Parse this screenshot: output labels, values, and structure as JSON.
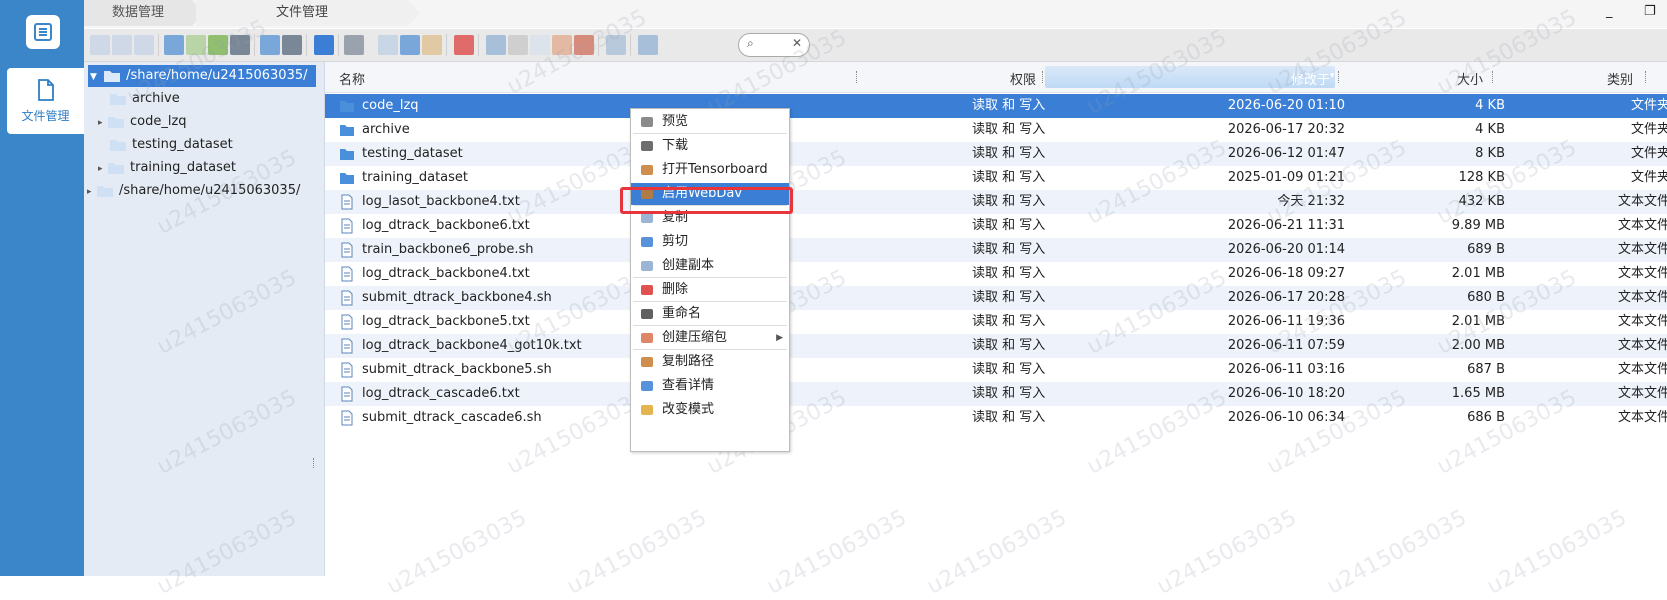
{
  "nav": {
    "active_label": "文件管理"
  },
  "tabs": [
    {
      "label": "数据管理"
    },
    {
      "label": "文件管理"
    }
  ],
  "window": {
    "minimize": "_",
    "restore": "❐"
  },
  "search": {
    "placeholder": "",
    "glyph": "⌕",
    "clear": "✕"
  },
  "tree": {
    "root": "/share/home/u2415063035/",
    "children": [
      "archive",
      "code_lzq",
      "testing_dataset",
      "training_dataset"
    ],
    "second_root": "/share/home/u2415063035/"
  },
  "columns": {
    "name": "名称",
    "perm": "权限",
    "modified": "修改于",
    "size": "大小",
    "type": "类别"
  },
  "files": [
    {
      "name": "code_lzq",
      "perm": "读取 和 写入",
      "modified": "2026-06-20 01:10",
      "size": "4 KB",
      "type": "文件夹",
      "kind": "folder"
    },
    {
      "name": "archive",
      "perm": "读取 和 写入",
      "modified": "2026-06-17 20:32",
      "size": "4 KB",
      "type": "文件夹",
      "kind": "folder"
    },
    {
      "name": "testing_dataset",
      "perm": "读取 和 写入",
      "modified": "2026-06-12 01:47",
      "size": "8 KB",
      "type": "文件夹",
      "kind": "folder"
    },
    {
      "name": "training_dataset",
      "perm": "读取 和 写入",
      "modified": "2025-01-09 01:21",
      "size": "128 KB",
      "type": "文件夹",
      "kind": "folder"
    },
    {
      "name": "log_lasot_backbone4.txt",
      "perm": "读取 和 写入",
      "modified": "今天 21:32",
      "size": "432 KB",
      "type": "文本文件",
      "kind": "file"
    },
    {
      "name": "log_dtrack_backbone6.txt",
      "perm": "读取 和 写入",
      "modified": "2026-06-21 11:31",
      "size": "9.89 MB",
      "type": "文本文件",
      "kind": "file"
    },
    {
      "name": "train_backbone6_probe.sh",
      "perm": "读取 和 写入",
      "modified": "2026-06-20 01:14",
      "size": "689 B",
      "type": "文本文件",
      "kind": "file"
    },
    {
      "name": "log_dtrack_backbone4.txt",
      "perm": "读取 和 写入",
      "modified": "2026-06-18 09:27",
      "size": "2.01 MB",
      "type": "文本文件",
      "kind": "file"
    },
    {
      "name": "submit_dtrack_backbone4.sh",
      "perm": "读取 和 写入",
      "modified": "2026-06-17 20:28",
      "size": "680 B",
      "type": "文本文件",
      "kind": "file"
    },
    {
      "name": "log_dtrack_backbone5.txt",
      "perm": "读取 和 写入",
      "modified": "2026-06-11 19:36",
      "size": "2.01 MB",
      "type": "文本文件",
      "kind": "file"
    },
    {
      "name": "log_dtrack_backbone4_got10k.txt",
      "perm": "读取 和 写入",
      "modified": "2026-06-11 07:59",
      "size": "2.00 MB",
      "type": "文本文件",
      "kind": "file"
    },
    {
      "name": "submit_dtrack_backbone5.sh",
      "perm": "读取 和 写入",
      "modified": "2026-06-11 03:16",
      "size": "687 B",
      "type": "文本文件",
      "kind": "file"
    },
    {
      "name": "log_dtrack_cascade6.txt",
      "perm": "读取 和 写入",
      "modified": "2026-06-10 18:20",
      "size": "1.65 MB",
      "type": "文本文件",
      "kind": "file"
    },
    {
      "name": "submit_dtrack_cascade6.sh",
      "perm": "读取 和 写入",
      "modified": "2026-06-10 06:34",
      "size": "686 B",
      "type": "文本文件",
      "kind": "file"
    }
  ],
  "context_menu": [
    {
      "label": "预览",
      "icon": "eye-icon"
    },
    {
      "label": "下载",
      "icon": "download-icon"
    },
    {
      "label": "打开Tensorboard",
      "icon": "home-icon"
    },
    {
      "label": "启用WebDav",
      "icon": "home-icon"
    },
    {
      "label": "复制",
      "icon": "copy-icon"
    },
    {
      "label": "剪切",
      "icon": "scissors-icon"
    },
    {
      "label": "创建副本",
      "icon": "duplicate-icon"
    },
    {
      "label": "删除",
      "icon": "delete-icon"
    },
    {
      "label": "重命名",
      "icon": "rename-icon"
    },
    {
      "label": "创建压缩包",
      "icon": "archive-icon"
    },
    {
      "label": "复制路径",
      "icon": "home-icon"
    },
    {
      "label": "查看详情",
      "icon": "info-icon"
    },
    {
      "label": "改变模式",
      "icon": "gear-icon"
    }
  ],
  "watermark": "u2415063035",
  "colors": {
    "accent": "#3a7fd5",
    "nav": "#3a86c9",
    "highlight": "#e8343b"
  }
}
